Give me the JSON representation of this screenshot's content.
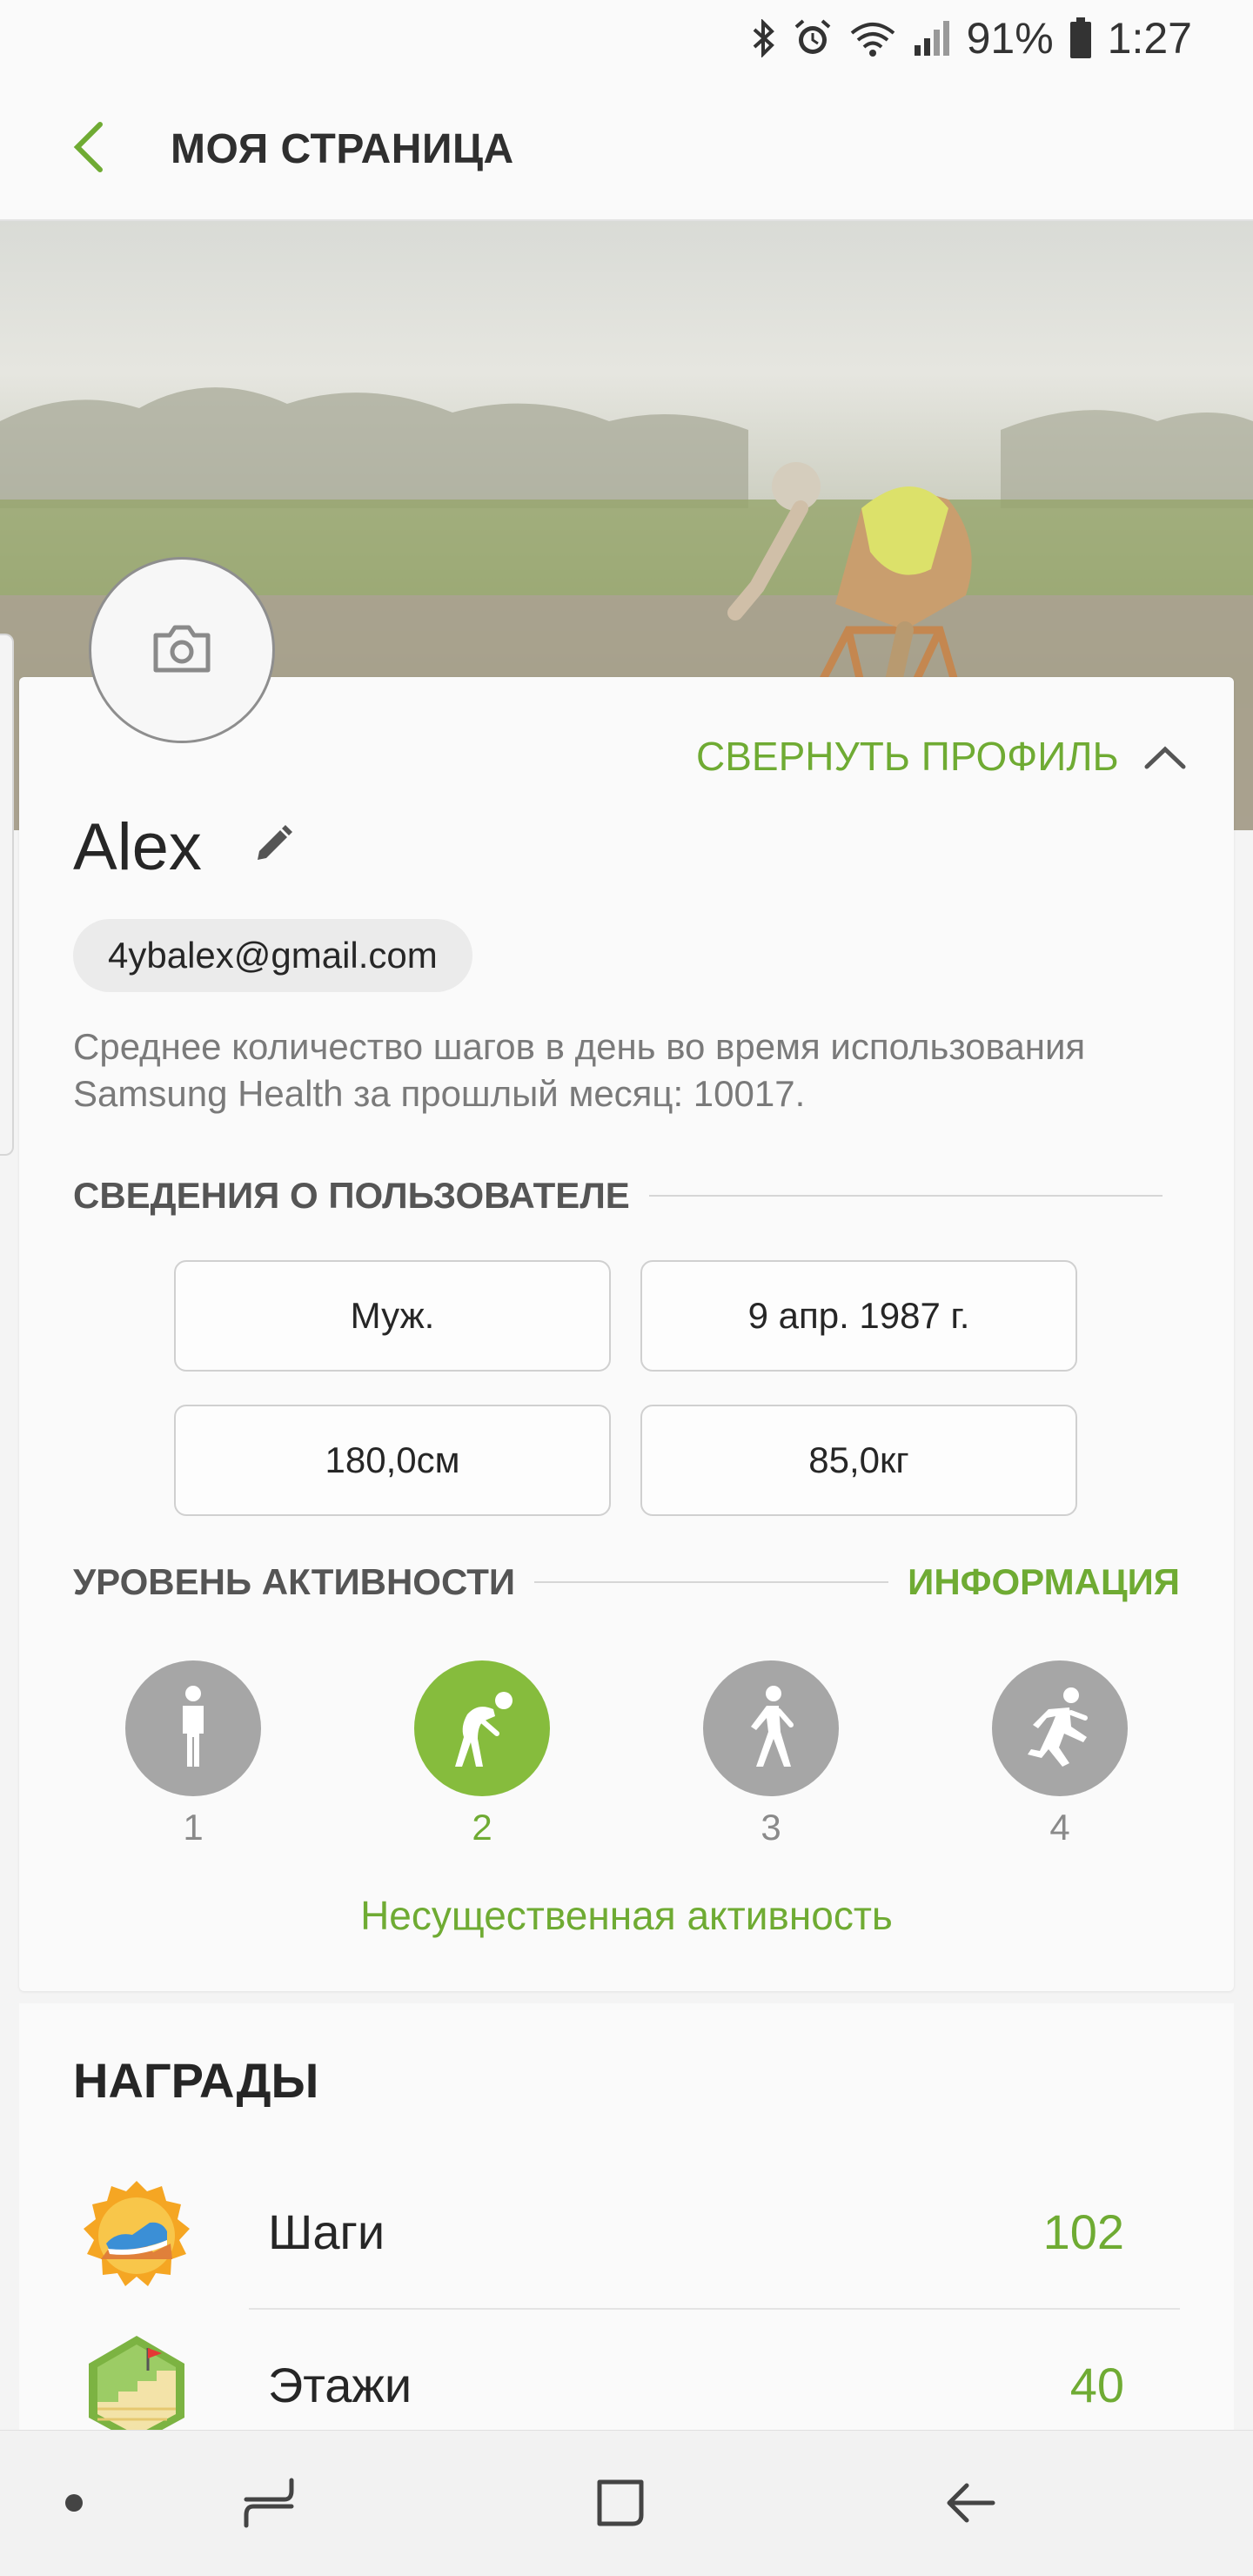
{
  "status_bar": {
    "battery": "91%",
    "time": "1:27",
    "icons": [
      "bluetooth-icon",
      "alarm-icon",
      "wifi-icon",
      "signal-icon",
      "battery-icon"
    ]
  },
  "header": {
    "title": "МОЯ СТРАНИЦА",
    "back_icon": "chevron-left-icon"
  },
  "profile": {
    "collapse_label": "СВЕРНУТЬ ПРОФИЛЬ",
    "name": "Alex",
    "email": "4ybalex@gmail.com",
    "steps_note": "Среднее количество шагов в день во время использования Samsung Health за прошлый месяц: 10017."
  },
  "user_info": {
    "title": "СВЕДЕНИЯ О ПОЛЬЗОВАТЕЛЕ",
    "gender": "Муж.",
    "birthdate": "9 апр. 1987 г.",
    "height": "180,0см",
    "weight": "85,0кг"
  },
  "activity": {
    "title": "УРОВЕНЬ АКТИВНОСТИ",
    "info_link": "ИНФОРМАЦИЯ",
    "levels": [
      {
        "num": "1",
        "icon": "standing-person-icon"
      },
      {
        "num": "2",
        "icon": "stretching-person-icon"
      },
      {
        "num": "3",
        "icon": "walking-person-icon"
      },
      {
        "num": "4",
        "icon": "running-person-icon"
      }
    ],
    "selected": "2",
    "description": "Несущественная активность"
  },
  "awards": {
    "title": "НАГРАДЫ",
    "items": [
      {
        "name": "Шаги",
        "count": "102",
        "icon": "sneaker-badge-icon"
      },
      {
        "name": "Этажи",
        "count": "40",
        "icon": "stairs-badge-icon"
      }
    ]
  },
  "nav": {
    "icons": [
      "dot-icon",
      "recents-icon",
      "home-icon",
      "back-arrow-icon"
    ]
  },
  "colors": {
    "accent": "#6fab33",
    "accent_fill": "#86bc3d",
    "inactive_level": "#a6a6a6"
  }
}
